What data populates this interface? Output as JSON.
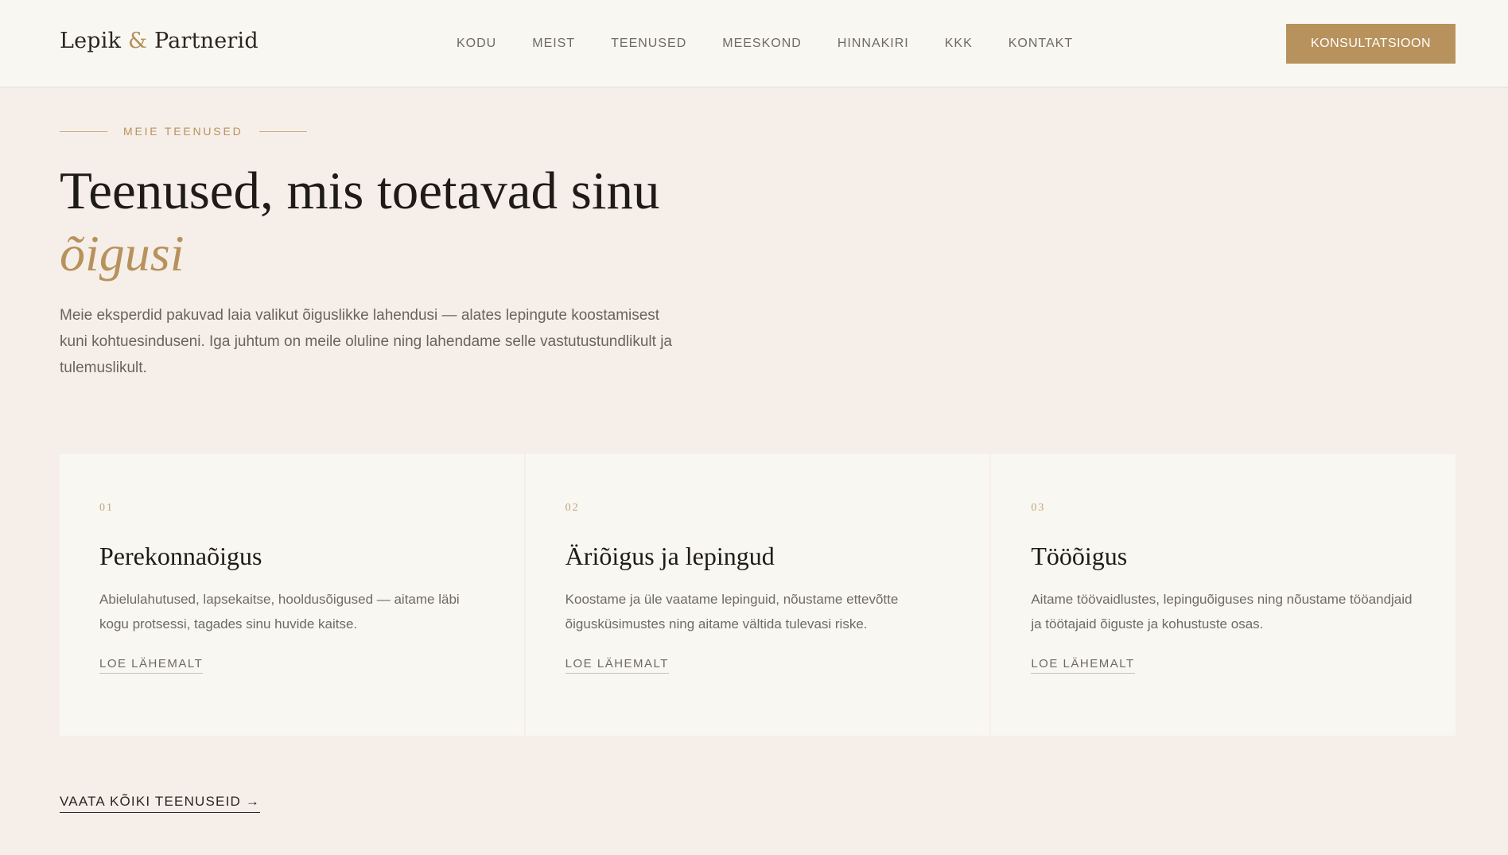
{
  "header": {
    "logo_left": "Lepik",
    "logo_amp": "&",
    "logo_right": "Partnerid",
    "nav": [
      "KODU",
      "MEIST",
      "TEENUSED",
      "MEESKOND",
      "HINNAKIRI",
      "KKK",
      "KONTAKT"
    ],
    "cta_label": "KONSULTATSIOON"
  },
  "hero": {
    "eyebrow": "MEIE TEENUSED",
    "headline": "Teenused, mis toetavad sinu",
    "headline_accent": "õigusi",
    "lead": "Meie eksperdid pakuvad laia valikut õiguslikke lahendusi — alates lepingute koostamisest kuni kohtuesinduseni. Iga juhtum on meile oluline ning lahendame selle vastutustundlikult ja tulemuslikult."
  },
  "services": [
    {
      "num": "01",
      "title": "Perekonnaõigus",
      "desc": "Abielulahutused, lapsekaitse, hooldusõigused — aitame läbi kogu protsessi, tagades sinu huvide kaitse.",
      "link": "LOE LÄHEMALT"
    },
    {
      "num": "02",
      "title": "Äriõigus ja lepingud",
      "desc": "Koostame ja üle vaatame lepinguid, nõustame ettevõtte õigusküsimustes ning aitame vältida tulevasi riske.",
      "link": "LOE LÄHEMALT"
    },
    {
      "num": "03",
      "title": "Tööõigus",
      "desc": "Aitame töövaidlustes, lepinguõiguses ning nõustame tööandjaid ja töötajaid õiguste ja kohustuste osas.",
      "link": "LOE LÄHEMALT"
    }
  ],
  "all_services_link": "VAATA KÕIKI TEENUSEID →",
  "colors": {
    "accent": "#b8925c",
    "page_bg": "#f6efe9",
    "card_bg": "#f9f7f2"
  }
}
